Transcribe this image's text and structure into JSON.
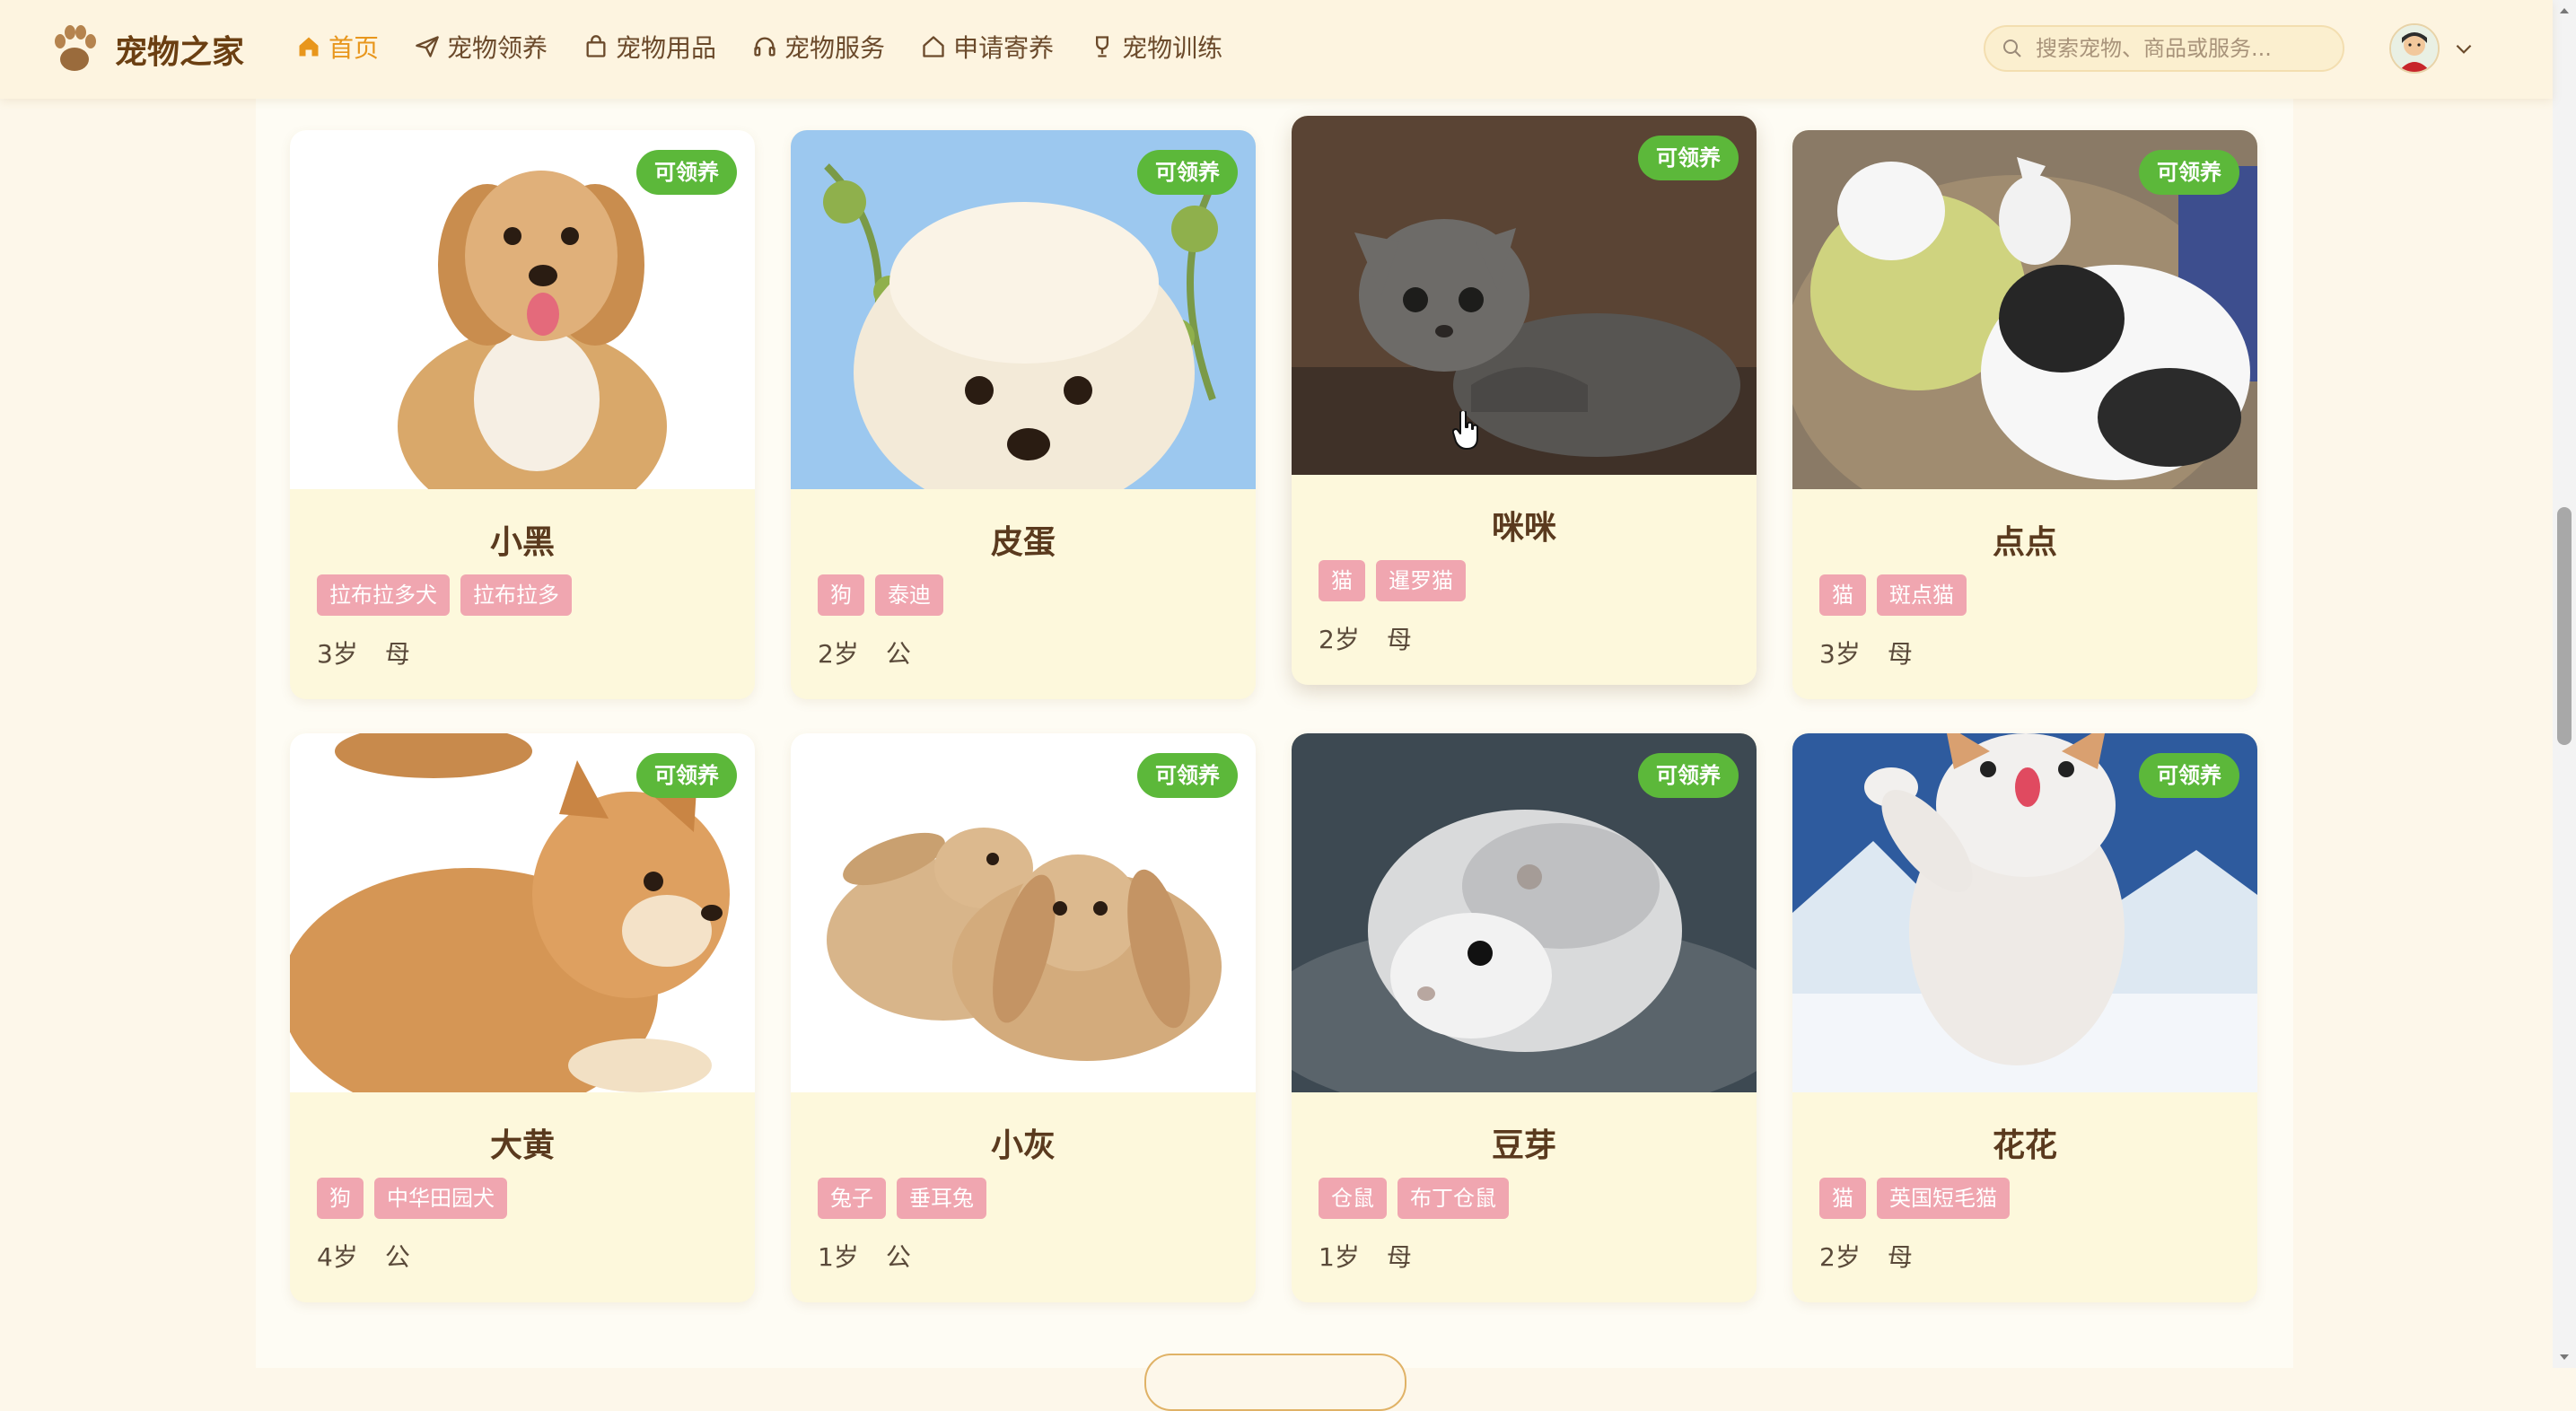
{
  "header": {
    "brand": "宠物之家",
    "nav": [
      {
        "label": "首页",
        "icon": "home-icon",
        "active": true
      },
      {
        "label": "宠物领养",
        "icon": "paper-plane-icon",
        "active": false
      },
      {
        "label": "宠物用品",
        "icon": "shopping-bag-icon",
        "active": false
      },
      {
        "label": "宠物服务",
        "icon": "headset-icon",
        "active": false
      },
      {
        "label": "申请寄养",
        "icon": "house-icon",
        "active": false
      },
      {
        "label": "宠物训练",
        "icon": "trophy-icon",
        "active": false
      }
    ],
    "search_placeholder": "搜索宠物、商品或服务..."
  },
  "pets": [
    {
      "name": "小黑",
      "status": "可领养",
      "tags": [
        "拉布拉多犬",
        "拉布拉多"
      ],
      "age": "3岁",
      "gender": "母",
      "photo": "fluffy-puppy"
    },
    {
      "name": "皮蛋",
      "status": "可领养",
      "tags": [
        "狗",
        "泰迪"
      ],
      "age": "2岁",
      "gender": "公",
      "photo": "white-dog-sky"
    },
    {
      "name": "咪咪",
      "status": "可领养",
      "tags": [
        "猫",
        "暹罗猫"
      ],
      "age": "2岁",
      "gender": "母",
      "photo": "tabby-kitten"
    },
    {
      "name": "点点",
      "status": "可领养",
      "tags": [
        "猫",
        "斑点猫"
      ],
      "age": "3岁",
      "gender": "母",
      "photo": "cats-in-basket"
    },
    {
      "name": "大黄",
      "status": "可领养",
      "tags": [
        "狗",
        "中华田园犬"
      ],
      "age": "4岁",
      "gender": "公",
      "photo": "shiba-puppy"
    },
    {
      "name": "小灰",
      "status": "可领养",
      "tags": [
        "兔子",
        "垂耳兔"
      ],
      "age": "1岁",
      "gender": "公",
      "photo": "two-rabbits"
    },
    {
      "name": "豆芽",
      "status": "可领养",
      "tags": [
        "仓鼠",
        "布丁仓鼠"
      ],
      "age": "1岁",
      "gender": "母",
      "photo": "hamster"
    },
    {
      "name": "花花",
      "status": "可领养",
      "tags": [
        "猫",
        "英国短毛猫"
      ],
      "age": "2岁",
      "gender": "母",
      "photo": "jumping-cat-snow"
    }
  ],
  "colors": {
    "accent": "#e8961c",
    "badge": "#5cb83a",
    "tag": "#f0a6b0",
    "card": "#fdf8dc"
  }
}
